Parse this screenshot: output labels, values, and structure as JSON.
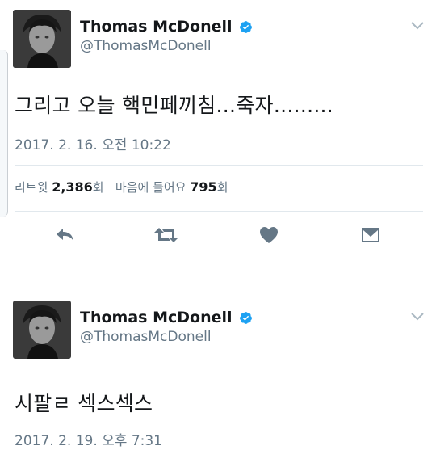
{
  "tweets": [
    {
      "author_name": "Thomas McDonell",
      "handle": "@ThomasMcDonell",
      "text": "그리고 오늘 핵민페끼침...죽자.........",
      "timestamp": "2017. 2. 16. 오전 10:22",
      "retweets_label": "리트윗",
      "retweets_count": "2,386",
      "retweets_unit": "회",
      "likes_label": "마음에 들어요",
      "likes_count": "795",
      "likes_unit": "회"
    },
    {
      "author_name": "Thomas McDonell",
      "handle": "@ThomasMcDonell",
      "text": "시팔ㄹ 섹스섹스",
      "timestamp": "2017. 2. 19. 오후 7:31"
    }
  ],
  "icons": {
    "verified": "verified-badge-icon",
    "menu": "chevron-down-icon",
    "reply": "reply-icon",
    "retweet": "retweet-icon",
    "like": "heart-icon",
    "dm": "envelope-icon"
  },
  "colors": {
    "verified_blue": "#1da1f2",
    "muted_text": "#657786",
    "divider": "#e1e8ed"
  }
}
